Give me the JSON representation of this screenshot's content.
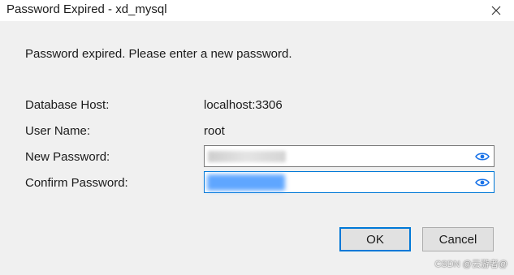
{
  "window": {
    "title": "Password Expired - xd_mysql",
    "close_icon": "close-icon"
  },
  "dialog": {
    "message": "Password expired. Please enter a new password.",
    "host_label": "Database Host:",
    "host_value": "localhost:3306",
    "user_label": "User Name:",
    "user_value": "root",
    "new_password_label": "New Password:",
    "confirm_password_label": "Confirm Password:",
    "reveal_icon": "eye-icon"
  },
  "buttons": {
    "ok": "OK",
    "cancel": "Cancel"
  },
  "watermark": "CSDN @云游者@",
  "colors": {
    "accent": "#0078d7",
    "eye_icon": "#1a73e8",
    "background": "#f0f0f0"
  }
}
